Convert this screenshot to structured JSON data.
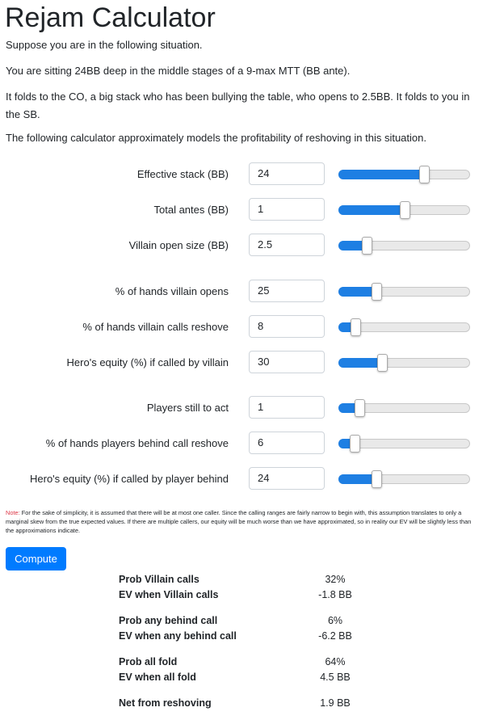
{
  "title": "Rejam Calculator",
  "intro": {
    "p1": "Suppose you are in the following situation.",
    "p2": "You are sitting 24BB deep in the middle stages of a 9-max MTT (BB ante).",
    "p3": "It folds to the CO, a big stack who has been bullying the table, who opens to 2.5BB. It folds to you in the SB.",
    "p4": "The following calculator approximately models the profitability of reshoving in this situation."
  },
  "inputs": [
    {
      "label": "Effective stack (BB)",
      "value": "24",
      "slider_fraction": 0.66
    },
    {
      "label": "Total antes (BB)",
      "value": "1",
      "slider_fraction": 0.5
    },
    {
      "label": "Villain open size (BB)",
      "value": "2.5",
      "slider_fraction": 0.19
    },
    {
      "label": "% of hands villain opens",
      "value": "25",
      "slider_fraction": 0.27
    },
    {
      "label": "% of hands villain calls reshove",
      "value": "8",
      "slider_fraction": 0.1
    },
    {
      "label": "Hero's equity (%) if called by villain",
      "value": "30",
      "slider_fraction": 0.32
    },
    {
      "label": "Players still to act",
      "value": "1",
      "slider_fraction": 0.13
    },
    {
      "label": "% of hands players behind call reshove",
      "value": "6",
      "slider_fraction": 0.09
    },
    {
      "label": "Hero's equity (%) if called by player behind",
      "value": "24",
      "slider_fraction": 0.27
    }
  ],
  "note": {
    "label": "Note:",
    "text": "For the sake of simplicity, it is assumed that there will be at most one caller. Since the calling ranges are fairly narrow to begin with, this assumption translates to only a marginal skew from the true expected values. If there are multiple callers, our equity will be much worse than we have approximated, so in reality our EV will be slightly less than the approximations indicate."
  },
  "compute_label": "Compute",
  "results": [
    {
      "label": "Prob Villain calls",
      "value": "32%"
    },
    {
      "label": "EV when Villain calls",
      "value": "-1.8 BB"
    },
    {
      "label": "Prob any behind call",
      "value": "6%"
    },
    {
      "label": "EV when any behind call",
      "value": "-6.2 BB"
    },
    {
      "label": "Prob all fold",
      "value": "64%"
    },
    {
      "label": "EV when all fold",
      "value": "4.5 BB"
    },
    {
      "label": "Net from reshoving",
      "value": "1.9 BB"
    }
  ],
  "colors": {
    "accent": "#007bff",
    "slider_fill": "#1e7fe3",
    "note_label": "#dc3545"
  }
}
